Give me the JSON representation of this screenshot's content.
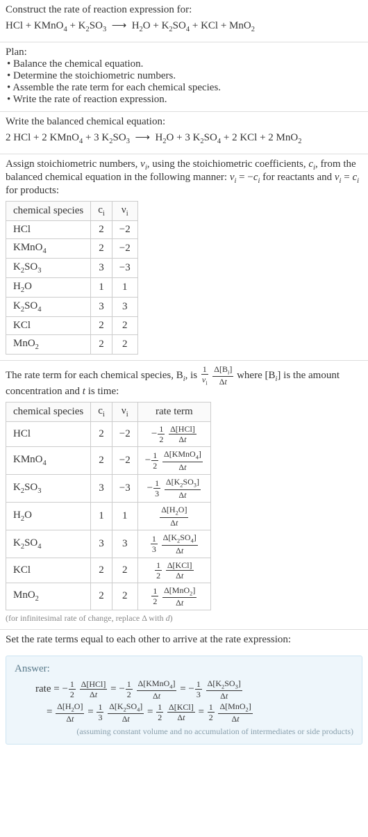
{
  "title": "Construct the rate of reaction expression for:",
  "unbalanced_eq_html": "HCl + KMnO<span class='sub'>4</span> + K<span class='sub'>2</span>SO<span class='sub'>3</span> &nbsp;&#10230;&nbsp; H<span class='sub'>2</span>O + K<span class='sub'>2</span>SO<span class='sub'>4</span> + KCl + MnO<span class='sub'>2</span>",
  "plan_heading": "Plan:",
  "plan_bullets": [
    "Balance the chemical equation.",
    "Determine the stoichiometric numbers.",
    "Assemble the rate term for each chemical species.",
    "Write the rate of reaction expression."
  ],
  "balanced_heading": "Write the balanced chemical equation:",
  "balanced_eq_html": "2 HCl + 2 KMnO<span class='sub'>4</span> + 3 K<span class='sub'>2</span>SO<span class='sub'>3</span> &nbsp;&#10230;&nbsp; H<span class='sub'>2</span>O + 3 K<span class='sub'>2</span>SO<span class='sub'>4</span> + 2 KCl + 2 MnO<span class='sub'>2</span>",
  "assign_heading_html": "Assign stoichiometric numbers, <span class='ital'>ν<span class='sub'>i</span></span>, using the stoichiometric coefficients, <span class='ital'>c<span class='sub'>i</span></span>, from the balanced chemical equation in the following manner: <span class='ital'>ν<span class='sub'>i</span></span> = −<span class='ital'>c<span class='sub'>i</span></span> for reactants and <span class='ital'>ν<span class='sub'>i</span></span> = <span class='ital'>c<span class='sub'>i</span></span> for products:",
  "table1_headers": [
    "chemical species",
    "c<span class='sub'>i</span>",
    "ν<span class='sub'>i</span>"
  ],
  "table1_rows": [
    {
      "species_html": "HCl",
      "c": "2",
      "nu": "−2"
    },
    {
      "species_html": "KMnO<span class='sub'>4</span>",
      "c": "2",
      "nu": "−2"
    },
    {
      "species_html": "K<span class='sub'>2</span>SO<span class='sub'>3</span>",
      "c": "3",
      "nu": "−3"
    },
    {
      "species_html": "H<span class='sub'>2</span>O",
      "c": "1",
      "nu": "1"
    },
    {
      "species_html": "K<span class='sub'>2</span>SO<span class='sub'>4</span>",
      "c": "3",
      "nu": "3"
    },
    {
      "species_html": "KCl",
      "c": "2",
      "nu": "2"
    },
    {
      "species_html": "MnO<span class='sub'>2</span>",
      "c": "2",
      "nu": "2"
    }
  ],
  "rateterm_intro_html": "The rate term for each chemical species, B<span class='sub'><span class='ital'>i</span></span>, is <span class='frac'><span class='num'>1</span><span class='den'><span class='ital'>ν</span><span class='sub'>i</span></span></span> <span class='frac'><span class='num'>Δ[B<span class='sub'><span class='ital'>i</span></span>]</span><span class='den'>Δ<span class='ital'>t</span></span></span> where [B<span class='sub'><span class='ital'>i</span></span>] is the amount concentration and <span class='ital'>t</span> is time:",
  "table2_headers": [
    "chemical species",
    "c<span class='sub'>i</span>",
    "ν<span class='sub'>i</span>",
    "rate term"
  ],
  "table2_rows": [
    {
      "species_html": "HCl",
      "c": "2",
      "nu": "−2",
      "rate_html": "−<span class='frac'><span class='num'>1</span><span class='den'>2</span></span> <span class='frac'><span class='num'>Δ[HCl]</span><span class='den'>Δ<span class='ital'>t</span></span></span>"
    },
    {
      "species_html": "KMnO<span class='sub'>4</span>",
      "c": "2",
      "nu": "−2",
      "rate_html": "−<span class='frac'><span class='num'>1</span><span class='den'>2</span></span> <span class='frac'><span class='num'>Δ[KMnO<span class='sub'>4</span>]</span><span class='den'>Δ<span class='ital'>t</span></span></span>"
    },
    {
      "species_html": "K<span class='sub'>2</span>SO<span class='sub'>3</span>",
      "c": "3",
      "nu": "−3",
      "rate_html": "−<span class='frac'><span class='num'>1</span><span class='den'>3</span></span> <span class='frac'><span class='num'>Δ[K<span class='sub'>2</span>SO<span class='sub'>3</span>]</span><span class='den'>Δ<span class='ital'>t</span></span></span>"
    },
    {
      "species_html": "H<span class='sub'>2</span>O",
      "c": "1",
      "nu": "1",
      "rate_html": "<span class='frac'><span class='num'>Δ[H<span class='sub'>2</span>O]</span><span class='den'>Δ<span class='ital'>t</span></span></span>"
    },
    {
      "species_html": "K<span class='sub'>2</span>SO<span class='sub'>4</span>",
      "c": "3",
      "nu": "3",
      "rate_html": "<span class='frac'><span class='num'>1</span><span class='den'>3</span></span> <span class='frac'><span class='num'>Δ[K<span class='sub'>2</span>SO<span class='sub'>4</span>]</span><span class='den'>Δ<span class='ital'>t</span></span></span>"
    },
    {
      "species_html": "KCl",
      "c": "2",
      "nu": "2",
      "rate_html": "<span class='frac'><span class='num'>1</span><span class='den'>2</span></span> <span class='frac'><span class='num'>Δ[KCl]</span><span class='den'>Δ<span class='ital'>t</span></span></span>"
    },
    {
      "species_html": "MnO<span class='sub'>2</span>",
      "c": "2",
      "nu": "2",
      "rate_html": "<span class='frac'><span class='num'>1</span><span class='den'>2</span></span> <span class='frac'><span class='num'>Δ[MnO<span class='sub'>2</span>]</span><span class='den'>Δ<span class='ital'>t</span></span></span>"
    }
  ],
  "footnote_html": "(for infinitesimal rate of change, replace Δ with <span class='ital'>d</span>)",
  "final_heading": "Set the rate terms equal to each other to arrive at the rate expression:",
  "answer_label": "Answer:",
  "rate_expr_line1_html": "rate = −<span class='frac'><span class='num'>1</span><span class='den'>2</span></span> <span class='frac'><span class='num'>Δ[HCl]</span><span class='den'>Δ<span class='ital'>t</span></span></span> = −<span class='frac'><span class='num'>1</span><span class='den'>2</span></span> <span class='frac'><span class='num'>Δ[KMnO<span class='sub'>4</span>]</span><span class='den'>Δ<span class='ital'>t</span></span></span> = −<span class='frac'><span class='num'>1</span><span class='den'>3</span></span> <span class='frac'><span class='num'>Δ[K<span class='sub'>2</span>SO<span class='sub'>3</span>]</span><span class='den'>Δ<span class='ital'>t</span></span></span>",
  "rate_expr_line2_html": "= <span class='frac'><span class='num'>Δ[H<span class='sub'>2</span>O]</span><span class='den'>Δ<span class='ital'>t</span></span></span> = <span class='frac'><span class='num'>1</span><span class='den'>3</span></span> <span class='frac'><span class='num'>Δ[K<span class='sub'>2</span>SO<span class='sub'>4</span>]</span><span class='den'>Δ<span class='ital'>t</span></span></span> = <span class='frac'><span class='num'>1</span><span class='den'>2</span></span> <span class='frac'><span class='num'>Δ[KCl]</span><span class='den'>Δ<span class='ital'>t</span></span></span> = <span class='frac'><span class='num'>1</span><span class='den'>2</span></span> <span class='frac'><span class='num'>Δ[MnO<span class='sub'>2</span>]</span><span class='den'>Δ<span class='ital'>t</span></span></span>",
  "assumption_note": "(assuming constant volume and no accumulation of intermediates or side products)"
}
